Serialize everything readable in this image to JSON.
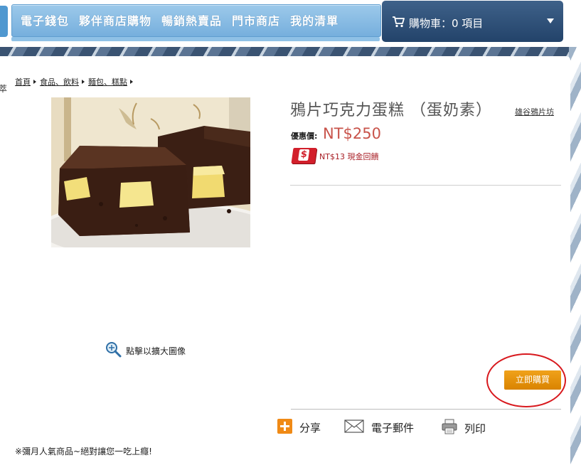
{
  "nav": {
    "items": [
      {
        "label": "電子錢包"
      },
      {
        "label": "夥伴商店購物"
      },
      {
        "label": "暢銷熱賣品"
      },
      {
        "label": "門市商店"
      },
      {
        "label": "我的清單"
      }
    ],
    "cart_label": "購物車：0 項目",
    "cart_icon": "cart-icon",
    "cart_arrow_icon": "caret-down-icon"
  },
  "left_cut_text": "萃",
  "breadcrumb": {
    "items": [
      {
        "label": "首頁"
      },
      {
        "label": "食品、飲料"
      },
      {
        "label": "麵包、糕點"
      }
    ]
  },
  "product": {
    "title": "鴉片巧克力蛋糕 （蛋奶素）",
    "brand": "雄谷鴉片坊",
    "price_label": "優惠價:",
    "price": "NT$250",
    "cashback": "NT$13 現金回饋",
    "cashback_icon": "cashback-dollar-icon",
    "image_alt_icon": "product-photo",
    "zoom_hint": "點擊以擴大圖像",
    "zoom_icon": "magnifier-icon"
  },
  "actions": {
    "buy_now": "立即購買",
    "share": "分享",
    "email": "電子郵件",
    "print": "列印"
  },
  "footnote": "※彌月人氣商品~絕對讓您一吃上癮!",
  "colors": {
    "price": "#c8534a",
    "buy_button": "#e8950f",
    "cart_bg": "#2f5079",
    "nav_bg": "#8dc0e5",
    "highlight": "#d8191e"
  }
}
